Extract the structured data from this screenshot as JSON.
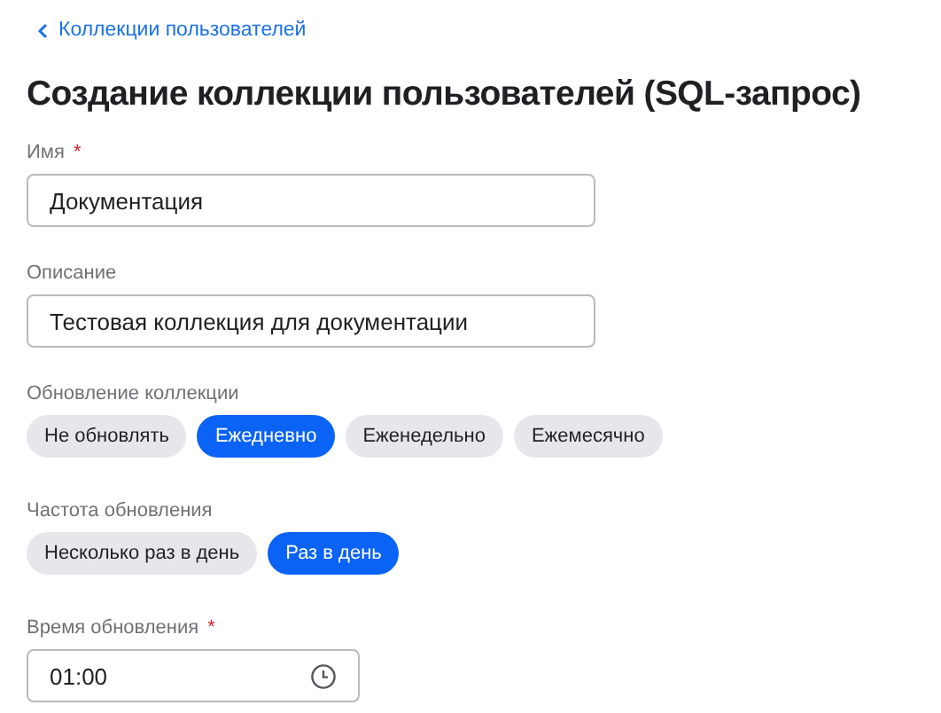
{
  "back_link": {
    "label": "Коллекции пользователей"
  },
  "title": "Создание коллекции пользователей (SQL-запрос)",
  "fields": [
    {
      "kind": "text",
      "label": "Имя",
      "required_mark": "*",
      "value": "Документация"
    },
    {
      "kind": "text",
      "label": "Описание",
      "value": "Тестовая коллекция для документации"
    },
    {
      "kind": "chips",
      "label": "Обновление коллекции",
      "options": [
        {
          "label": "Не обновлять",
          "selected": false
        },
        {
          "label": "Ежедневно",
          "selected": true
        },
        {
          "label": "Еженедельно",
          "selected": false
        },
        {
          "label": "Ежемесячно",
          "selected": false
        }
      ]
    },
    {
      "kind": "chips",
      "label": "Частота обновления",
      "options": [
        {
          "label": "Несколько раз в день",
          "selected": false
        },
        {
          "label": "Раз в день",
          "selected": true
        }
      ]
    },
    {
      "kind": "time",
      "label": "Время обновления",
      "required_mark": "*",
      "value": "01:00"
    }
  ]
}
